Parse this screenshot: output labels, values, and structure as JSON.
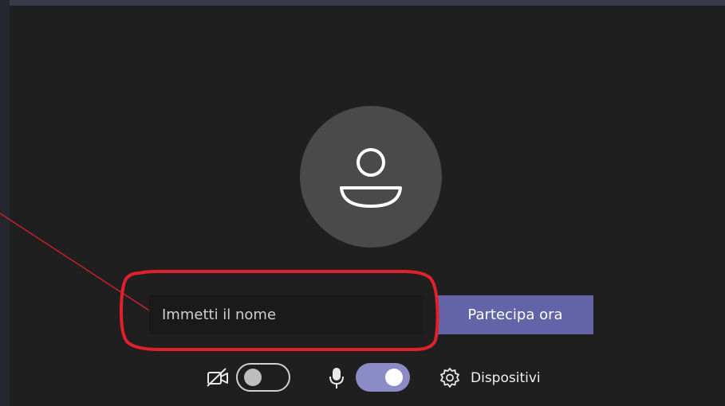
{
  "prejoin": {
    "name_placeholder": "Immetti il nome",
    "join_label": "Partecipa ora",
    "devices_label": "Dispositivi"
  },
  "controls": {
    "camera_enabled": false,
    "microphone_enabled": true
  },
  "icons": {
    "avatar": "person-icon",
    "camera": "camera-off-icon",
    "microphone": "microphone-icon",
    "devices": "gear-icon"
  },
  "colors": {
    "background": "#201f1f",
    "input_background": "#1b1a1a",
    "accent": "#6264a7",
    "toggle_on": "#8b8cc7",
    "annotation": "#e0202a"
  }
}
